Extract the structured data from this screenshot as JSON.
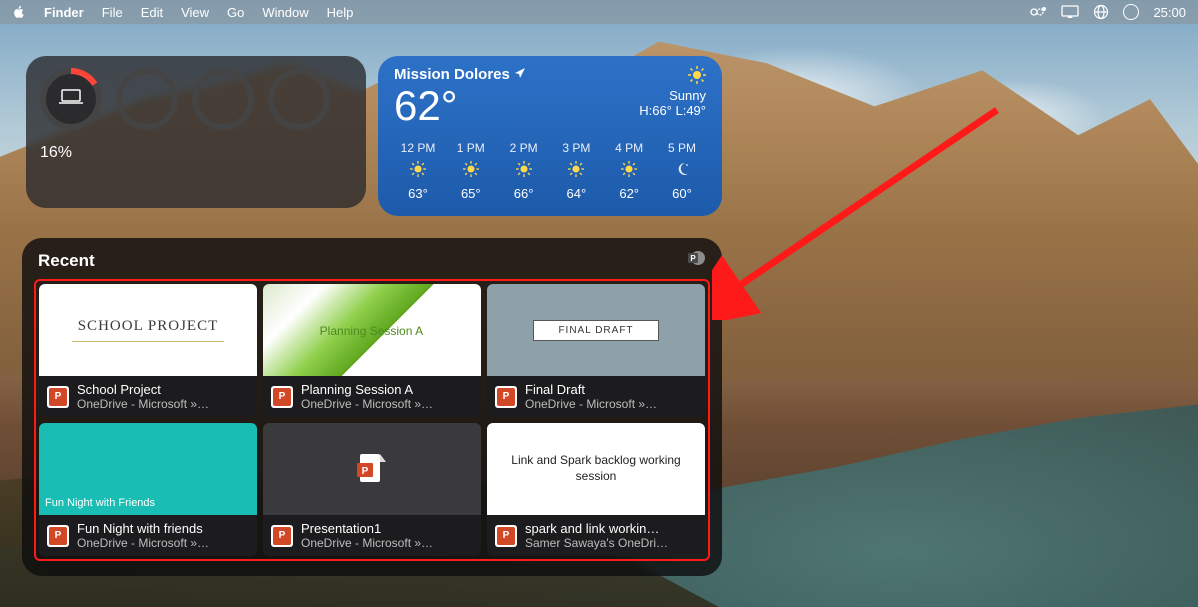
{
  "menubar": {
    "app": "Finder",
    "items": [
      "File",
      "Edit",
      "View",
      "Go",
      "Window",
      "Help"
    ],
    "clock": "25:00"
  },
  "system_widget": {
    "percent_label": "16%"
  },
  "weather": {
    "location": "Mission Dolores",
    "temp": "62°",
    "condition": "Sunny",
    "hilo": "H:66° L:49°",
    "hourly": [
      {
        "time": "12 PM",
        "icon": "sun",
        "temp": "63°"
      },
      {
        "time": "1 PM",
        "icon": "sun",
        "temp": "65°"
      },
      {
        "time": "2 PM",
        "icon": "sun",
        "temp": "66°"
      },
      {
        "time": "3 PM",
        "icon": "sun",
        "temp": "64°"
      },
      {
        "time": "4 PM",
        "icon": "sun",
        "temp": "62°"
      },
      {
        "time": "5 PM",
        "icon": "moon",
        "temp": "60°"
      }
    ]
  },
  "recent": {
    "title": "Recent",
    "items": [
      {
        "thumb_title": "SCHOOL PROJECT",
        "name": "School Project",
        "loc": "OneDrive - Microsoft »…"
      },
      {
        "thumb_title": "Planning Session A",
        "name": "Planning Session A",
        "loc": "OneDrive - Microsoft »…"
      },
      {
        "thumb_title": "FINAL DRAFT",
        "name": "Final Draft",
        "loc": "OneDrive - Microsoft »…"
      },
      {
        "thumb_title": "Fun Night with Friends",
        "name": "Fun Night with friends",
        "loc": "OneDrive - Microsoft »…"
      },
      {
        "thumb_title": "",
        "name": "Presentation1",
        "loc": "OneDrive - Microsoft »…"
      },
      {
        "thumb_title": "Link and Spark backlog working session",
        "name": "spark and link workin…",
        "loc": "Samer Sawaya's OneDri…"
      }
    ]
  }
}
